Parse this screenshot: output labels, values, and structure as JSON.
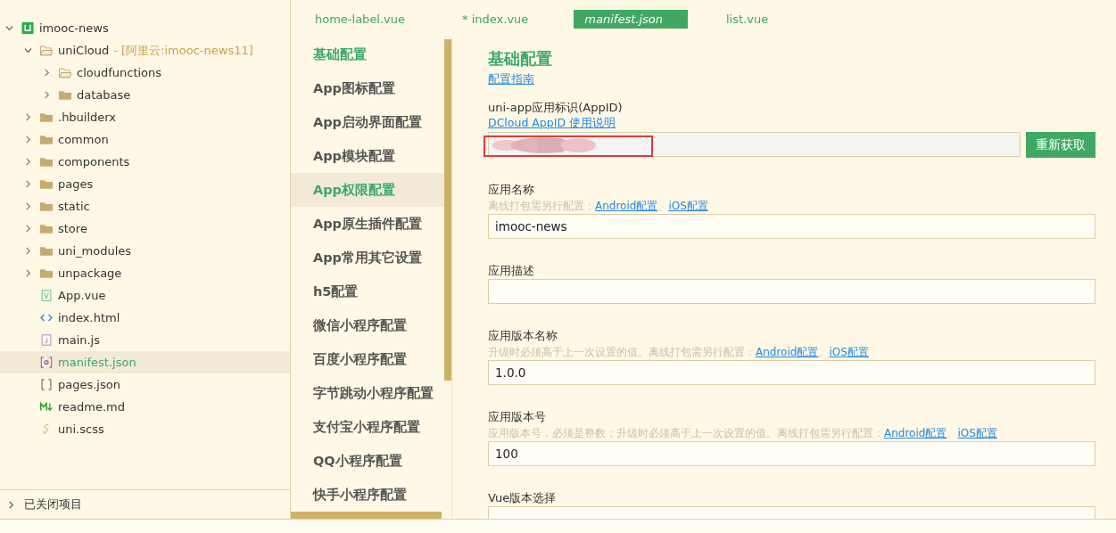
{
  "explorer": {
    "tree": [
      {
        "label": "imooc-news",
        "kind": "project",
        "expanded": true,
        "selected": false,
        "children": [
          {
            "label": "uniCloud",
            "note": "- [阿里云:imooc-news11]",
            "kind": "open-folder",
            "expanded": true,
            "selected": false,
            "children": [
              {
                "label": "cloudfunctions",
                "kind": "open-folder",
                "expanded": false,
                "selected": false
              },
              {
                "label": "database",
                "kind": "folder",
                "expanded": false,
                "selected": false
              }
            ]
          },
          {
            "label": ".hbuilderx",
            "kind": "folder",
            "expanded": false,
            "selected": false
          },
          {
            "label": "common",
            "kind": "folder",
            "expanded": false,
            "selected": false
          },
          {
            "label": "components",
            "kind": "folder",
            "expanded": false,
            "selected": false
          },
          {
            "label": "pages",
            "kind": "folder",
            "expanded": false,
            "selected": false
          },
          {
            "label": "static",
            "kind": "folder",
            "expanded": false,
            "selected": false
          },
          {
            "label": "store",
            "kind": "folder",
            "expanded": false,
            "selected": false
          },
          {
            "label": "uni_modules",
            "kind": "folder",
            "expanded": false,
            "selected": false
          },
          {
            "label": "unpackage",
            "kind": "folder",
            "expanded": false,
            "selected": false
          },
          {
            "label": "App.vue",
            "kind": "vue",
            "selected": false
          },
          {
            "label": "index.html",
            "kind": "html",
            "selected": false
          },
          {
            "label": "main.js",
            "kind": "js",
            "selected": false
          },
          {
            "label": "manifest.json",
            "kind": "manifest",
            "selected": true
          },
          {
            "label": "pages.json",
            "kind": "json",
            "selected": false
          },
          {
            "label": "readme.md",
            "kind": "md",
            "selected": false
          },
          {
            "label": "uni.scss",
            "kind": "scss",
            "selected": false
          }
        ]
      }
    ],
    "closed_projects": {
      "label": "已关闭项目",
      "expanded": false
    }
  },
  "tabs": [
    {
      "label": "home-label.vue",
      "selected": false
    },
    {
      "label": "* index.vue",
      "selected": false
    },
    {
      "label": "manifest.json",
      "selected": true
    },
    {
      "label": "list.vue",
      "selected": false
    }
  ],
  "settings_nav": [
    {
      "label": "基础配置",
      "highlighted": true,
      "selected": false
    },
    {
      "label": "App图标配置",
      "highlighted": false,
      "selected": false
    },
    {
      "label": "App启动界面配置",
      "highlighted": false,
      "selected": false
    },
    {
      "label": "App模块配置",
      "highlighted": false,
      "selected": false
    },
    {
      "label": "App权限配置",
      "highlighted": true,
      "selected": true
    },
    {
      "label": "App原生插件配置",
      "highlighted": false,
      "selected": false
    },
    {
      "label": "App常用其它设置",
      "highlighted": false,
      "selected": false
    },
    {
      "label": "h5配置",
      "highlighted": false,
      "selected": false
    },
    {
      "label": "微信小程序配置",
      "highlighted": false,
      "selected": false
    },
    {
      "label": "百度小程序配置",
      "highlighted": false,
      "selected": false
    },
    {
      "label": "字节跳动小程序配置",
      "highlighted": false,
      "selected": false
    },
    {
      "label": "支付宝小程序配置",
      "highlighted": false,
      "selected": false
    },
    {
      "label": "QQ小程序配置",
      "highlighted": false,
      "selected": false
    },
    {
      "label": "快手小程序配置",
      "highlighted": false,
      "selected": false
    }
  ],
  "content": {
    "title": "基础配置",
    "guide_link": "配置指南",
    "fields": [
      {
        "kind": "appid",
        "label": "uni-app应用标识(AppID)",
        "link": "DCloud AppID 使用说明",
        "redacted": true,
        "outlined": true,
        "button": "重新获取"
      },
      {
        "kind": "text",
        "label": "应用名称",
        "hint": [
          {
            "text": "离线打包需另行配置：",
            "kind": "text"
          },
          {
            "text": "Android配置",
            "kind": "link"
          },
          {
            "text": "、",
            "kind": "text"
          },
          {
            "text": "iOS配置",
            "kind": "link"
          }
        ],
        "value": "imooc-news"
      },
      {
        "kind": "text",
        "label": "应用描述"
      },
      {
        "kind": "text",
        "label": "应用版本名称",
        "hint": [
          {
            "text": "升级时必须高于上一次设置的值。离线打包需另行配置：",
            "kind": "text"
          },
          {
            "text": "Android配置",
            "kind": "link"
          },
          {
            "text": "、",
            "kind": "text"
          },
          {
            "text": "iOS配置",
            "kind": "link"
          }
        ],
        "value": "1.0.0"
      },
      {
        "kind": "text",
        "label": "应用版本号",
        "hint": [
          {
            "text": "应用版本号，必须是整数；升级时必须高于上一次设置的值。离线打包需另行配置：",
            "kind": "text"
          },
          {
            "text": "Android配置",
            "kind": "link"
          },
          {
            "text": "、",
            "kind": "text"
          },
          {
            "text": "iOS配置",
            "kind": "link"
          }
        ],
        "value": "100"
      },
      {
        "kind": "text",
        "label": "Vue版本选择"
      }
    ]
  }
}
